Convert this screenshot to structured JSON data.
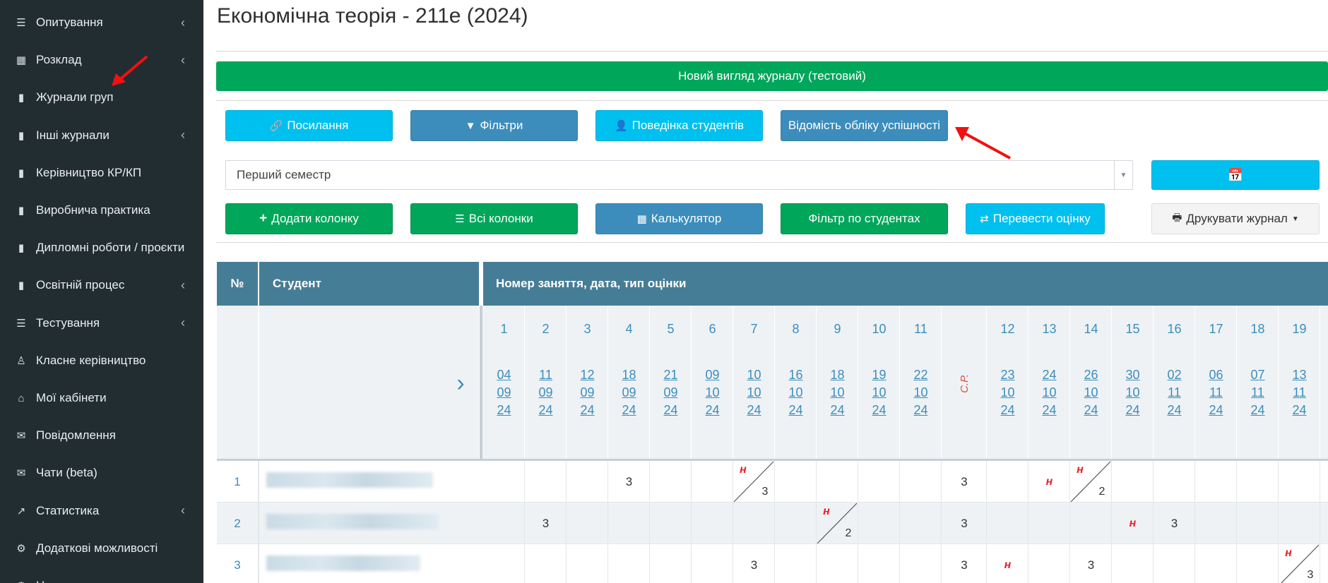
{
  "sidebar": {
    "items": [
      {
        "label": "Опитування",
        "icon": "list-icon",
        "chevron": true
      },
      {
        "label": "Розклад",
        "icon": "calendar-icon",
        "chevron": true
      },
      {
        "label": "Журнали груп",
        "icon": "book-icon",
        "chevron": false
      },
      {
        "label": "Інші журнали",
        "icon": "book-icon",
        "chevron": true
      },
      {
        "label": "Керівництво КР/КП",
        "icon": "book-icon",
        "chevron": false
      },
      {
        "label": "Виробнича практика",
        "icon": "book-icon",
        "chevron": false
      },
      {
        "label": "Дипломні роботи / проєкти",
        "icon": "book-icon",
        "chevron": false
      },
      {
        "label": "Освітній процес",
        "icon": "book-icon",
        "chevron": true
      },
      {
        "label": "Тестування",
        "icon": "list-icon",
        "chevron": true
      },
      {
        "label": "Класне керівництво",
        "icon": "user-icon",
        "chevron": false
      },
      {
        "label": "Мої кабінети",
        "icon": "bank-icon",
        "chevron": false
      },
      {
        "label": "Повідомлення",
        "icon": "envelope-icon",
        "chevron": false
      },
      {
        "label": "Чати (beta)",
        "icon": "envelope-icon",
        "chevron": false
      },
      {
        "label": "Статистика",
        "icon": "chart-icon",
        "chevron": true
      },
      {
        "label": "Додаткові можливості",
        "icon": "gear-icon",
        "chevron": false
      },
      {
        "label": "Н...",
        "icon": "gear-icon",
        "chevron": false
      }
    ]
  },
  "page": {
    "title": "Економічна теорія - 211е (2024)",
    "new_view": "Новий вигляд журналу (тестовий)"
  },
  "toolbar1": {
    "links": "Посилання",
    "filters": "Фільтри",
    "behavior": "Поведінка студентів",
    "statement": "Відомість обліку успішності"
  },
  "semester": {
    "value": "Перший семестр"
  },
  "toolbar2": {
    "add_column": "Додати колонку",
    "all_columns": "Всі колонки",
    "calculator": "Калькулятор",
    "student_filter": "Фільтр по студентах",
    "convert_grade": "Перевести оцінку",
    "print_journal": "Друкувати журнал"
  },
  "table": {
    "col_num": "№",
    "col_student": "Студент",
    "col_lessons": "Номер заняття, дата, тип оцінки",
    "lessons": [
      {
        "n": "1",
        "d": "04",
        "m": "09",
        "y": "24"
      },
      {
        "n": "2",
        "d": "11",
        "m": "09",
        "y": "24"
      },
      {
        "n": "3",
        "d": "12",
        "m": "09",
        "y": "24"
      },
      {
        "n": "4",
        "d": "18",
        "m": "09",
        "y": "24"
      },
      {
        "n": "5",
        "d": "21",
        "m": "09",
        "y": "24"
      },
      {
        "n": "6",
        "d": "09",
        "m": "10",
        "y": "24"
      },
      {
        "n": "7",
        "d": "10",
        "m": "10",
        "y": "24"
      },
      {
        "n": "8",
        "d": "16",
        "m": "10",
        "y": "24"
      },
      {
        "n": "9",
        "d": "18",
        "m": "10",
        "y": "24"
      },
      {
        "n": "10",
        "d": "19",
        "m": "10",
        "y": "24"
      },
      {
        "n": "11",
        "d": "22",
        "m": "10",
        "y": "24"
      },
      {
        "n": "",
        "cp": "С.Р."
      },
      {
        "n": "12",
        "d": "23",
        "m": "10",
        "y": "24"
      },
      {
        "n": "13",
        "d": "24",
        "m": "10",
        "y": "24"
      },
      {
        "n": "14",
        "d": "26",
        "m": "10",
        "y": "24"
      },
      {
        "n": "15",
        "d": "30",
        "m": "10",
        "y": "24"
      },
      {
        "n": "16",
        "d": "02",
        "m": "11",
        "y": "24"
      },
      {
        "n": "17",
        "d": "06",
        "m": "11",
        "y": "24"
      },
      {
        "n": "18",
        "d": "07",
        "m": "11",
        "y": "24"
      },
      {
        "n": "19",
        "d": "13",
        "m": "11",
        "y": "24"
      }
    ],
    "rows": [
      {
        "num": "1",
        "cells": [
          "",
          "",
          "",
          "3",
          "",
          "",
          "н/3",
          "",
          "",
          "",
          "",
          "3",
          "",
          "н",
          "н/2",
          "",
          "",
          "",
          "",
          ""
        ]
      },
      {
        "num": "2",
        "cells": [
          "",
          "3",
          "",
          "",
          "",
          "",
          "",
          "",
          "н/2",
          "",
          "",
          "3",
          "",
          "",
          "",
          "н",
          "3",
          "",
          "",
          ""
        ]
      },
      {
        "num": "3",
        "cells": [
          "",
          "",
          "",
          "",
          "",
          "",
          "3",
          "",
          "",
          "",
          "",
          "3",
          "н",
          "",
          "3",
          "",
          "",
          "",
          "",
          "н/3"
        ]
      }
    ]
  }
}
